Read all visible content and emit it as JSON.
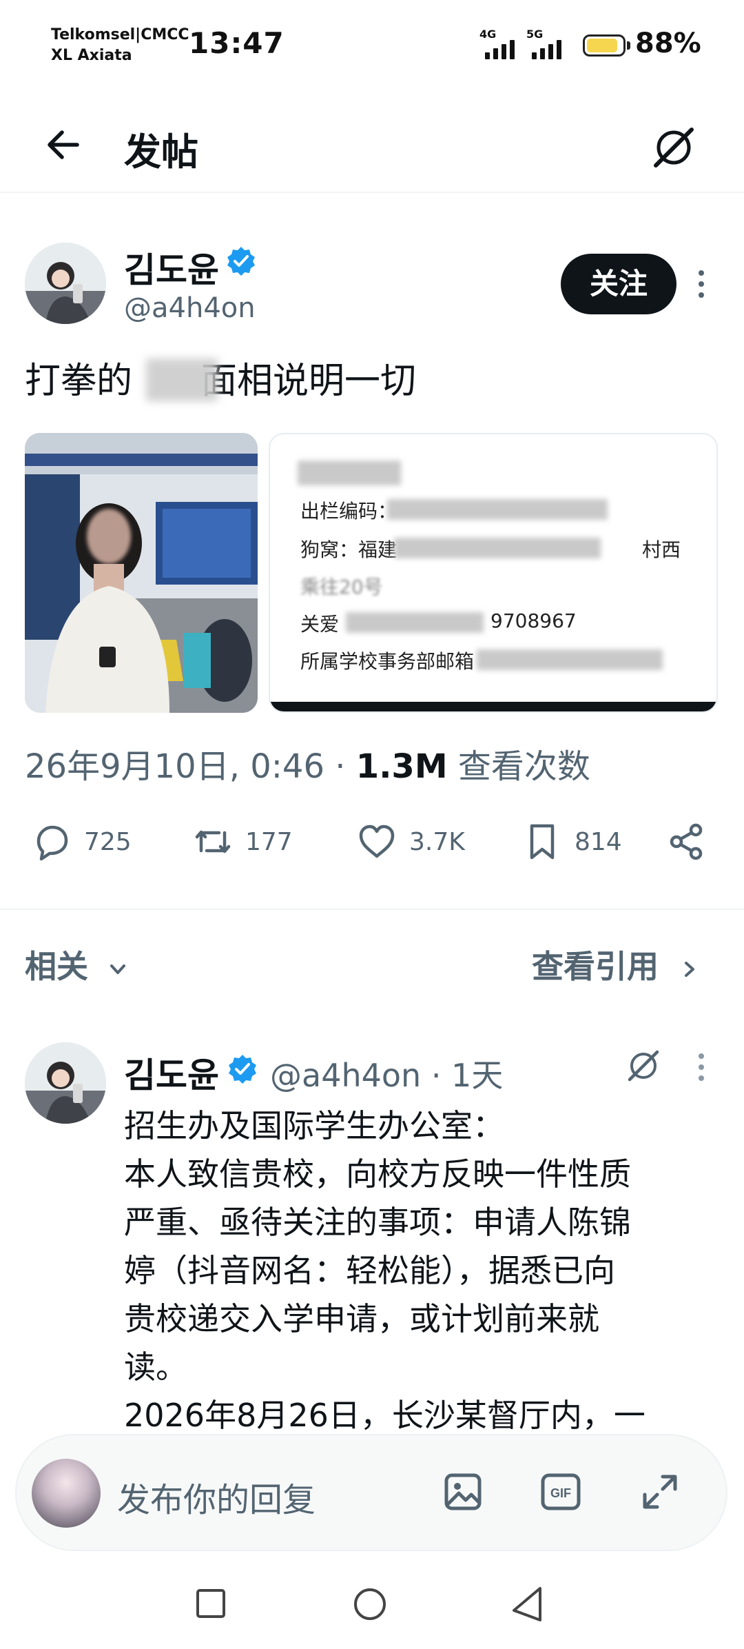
{
  "status_bar": {
    "carrier_line1": "Telkomsel|CMCC",
    "carrier_line2": "XL Axiata",
    "time": "13:47",
    "network1": "4G",
    "network2": "5G",
    "battery_level": 0.88,
    "battery_percent": "88%",
    "battery_color": "#f5d64e"
  },
  "header": {
    "title": "发帖"
  },
  "post": {
    "author_name": "김도윤",
    "author_handle": "@a4h4on",
    "follow_label": "关注",
    "text": "打拳的              面相说明一切",
    "text_before_blur": "打拳的",
    "text_after_blur": "面相说明一切",
    "media2_lines": [
      "出栏编码：",
      "狗窝：福建",
      "乘往20号",
      "关爱",
      "所属学校事务部邮箱"
    ],
    "media2_partial": [
      "9708967",
      "村西"
    ],
    "date": "26年9月10日, 0:46",
    "views": "1.3M",
    "views_label": "查看次数",
    "replies": "725",
    "reposts": "177",
    "likes": "3.7K",
    "bookmarks": "814"
  },
  "related": {
    "label": "相关",
    "quotes_label": "查看引用"
  },
  "reply": {
    "author_name": "김도윤",
    "author_handle": "@a4h4on",
    "time": "· 1天",
    "lines": [
      "招生办及国际学生办公室：",
      "本人致信贵校，向校方反映一件性质",
      "严重、亟待关注的事项：申请人陈锦",
      "婷（抖音网名：轻松能），据悉已向",
      "贵校递交入学申请，或计划前来就",
      "读。",
      "2026年8月26日，长沙某督厅内，一"
    ]
  },
  "composer": {
    "placeholder": "发布你的回复"
  },
  "colors": {
    "brand_blue": "#1d9bf0",
    "text_primary": "#0f1419",
    "text_secondary": "#536471"
  }
}
